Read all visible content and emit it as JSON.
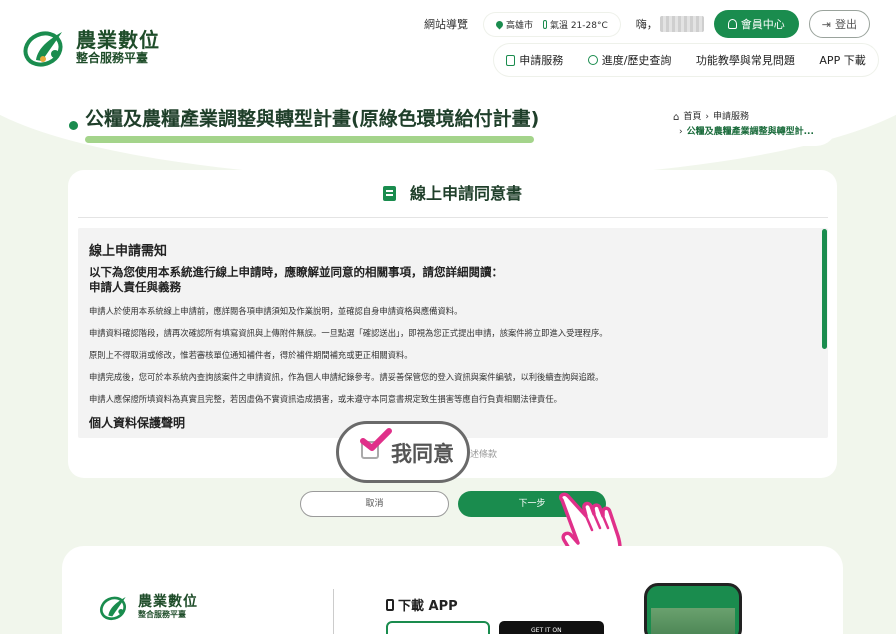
{
  "site": {
    "logo_line1": "農業數位",
    "logo_line2": "整合服務平臺"
  },
  "topbar": {
    "sitemap": "網站導覽",
    "location": "高雄市",
    "temperature": "氣溫 21-28°C",
    "greeting": "嗨，",
    "member_center": "會員中心",
    "logout": "登出"
  },
  "nav": {
    "items": [
      "申請服務",
      "進度/歷史查詢",
      "功能教學與常見問題",
      "APP 下載"
    ]
  },
  "page": {
    "title": "公糧及農糧產業調整與轉型計畫(原綠色環境給付計畫)"
  },
  "breadcrumb": {
    "home": "首頁",
    "level1": "申請服務",
    "current": "公糧及農糧產業調整與轉型計..."
  },
  "agreement": {
    "heading": "線上申請同意書",
    "section1": "線上申請需知",
    "lead1": "以下為您使用本系統進行線上申請時，應瞭解並同意的相關事項，請您詳細閱讀：",
    "lead2": "申請人責任與義務",
    "paragraphs": [
      "申請人於使用本系統線上申請前，應詳閱各項申請須知及作業說明，並確認自身申請資格與應備資料。",
      "申請資料確認階段，請再次確認所有填寫資訊與上傳附件無誤。一旦點選「確認送出」，即視為您正式提出申請，該案件將立即進入受理程序。",
      "原則上不得取消或修改，惟若審核單位通知補件者，得於補件期間補充或更正相關資料。",
      "申請完成後，您可於本系統內查詢該案件之申請資訊，作為個人申請紀錄參考。請妥善保管您的登入資訊與案件編號，以利後續查詢與追蹤。",
      "申請人應保證所填資料為真實且完整，若因虛偽不實資訊造成損害，或未遵守本同意書規定致生損害等應自行負責相關法律責任。"
    ],
    "section2": "個人資料保護聲明",
    "agree_label": "我同意",
    "agree_tail": "述條款",
    "cancel": "取消",
    "next": "下一步"
  },
  "footer": {
    "logo_line1": "農業數位",
    "logo_line2": "整合服務平臺",
    "download_app": "下載 APP",
    "store_text": "GET IT ON"
  },
  "colors": {
    "brand_green": "#1a8c4e",
    "title_bar": "#a4d48b",
    "annotation_pink": "#e0308a",
    "bg": "#f1f6ec"
  }
}
